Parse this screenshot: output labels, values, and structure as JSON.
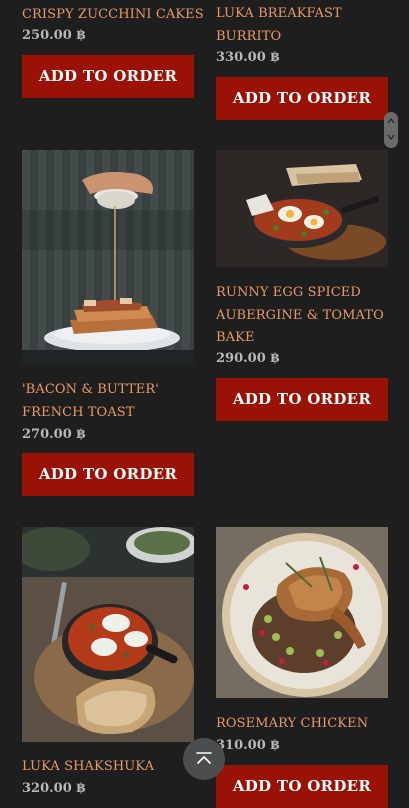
{
  "menu": {
    "items": [
      {
        "title": "CRISPY ZUCCHINI CAKES",
        "price": "250.00 ฿",
        "button": "ADD TO ORDER"
      },
      {
        "title": "LUKA BREAKFAST BURRITO",
        "price": "330.00 ฿",
        "button": "ADD TO ORDER"
      },
      {
        "title": "'BACON & BUTTER' FRENCH TOAST",
        "price": "270.00 ฿",
        "button": "ADD TO ORDER"
      },
      {
        "title": "RUNNY EGG SPICED AUBERGINE & TOMATO BAKE",
        "price": "290.00 ฿",
        "button": "ADD TO ORDER"
      },
      {
        "title": "LUKA SHAKSHUKA",
        "price": "320.00 ฿",
        "button": "ADD TO ORDER"
      },
      {
        "title": "ROSEMARY CHICKEN",
        "price": "310.00 ฿",
        "button": "ADD TO ORDER"
      }
    ]
  },
  "icons": {
    "scroll_top": "arrow-up-to-top-icon",
    "scrollbar_up": "chevron-up-icon",
    "scrollbar_down": "chevron-down-icon"
  },
  "colors": {
    "background": "#1d1e1d",
    "title": "#e99a6a",
    "price": "#b9b9b9",
    "button": "#9a1206",
    "button_text": "#ffffff",
    "scroll_top_bg": "#4b4d4f"
  }
}
